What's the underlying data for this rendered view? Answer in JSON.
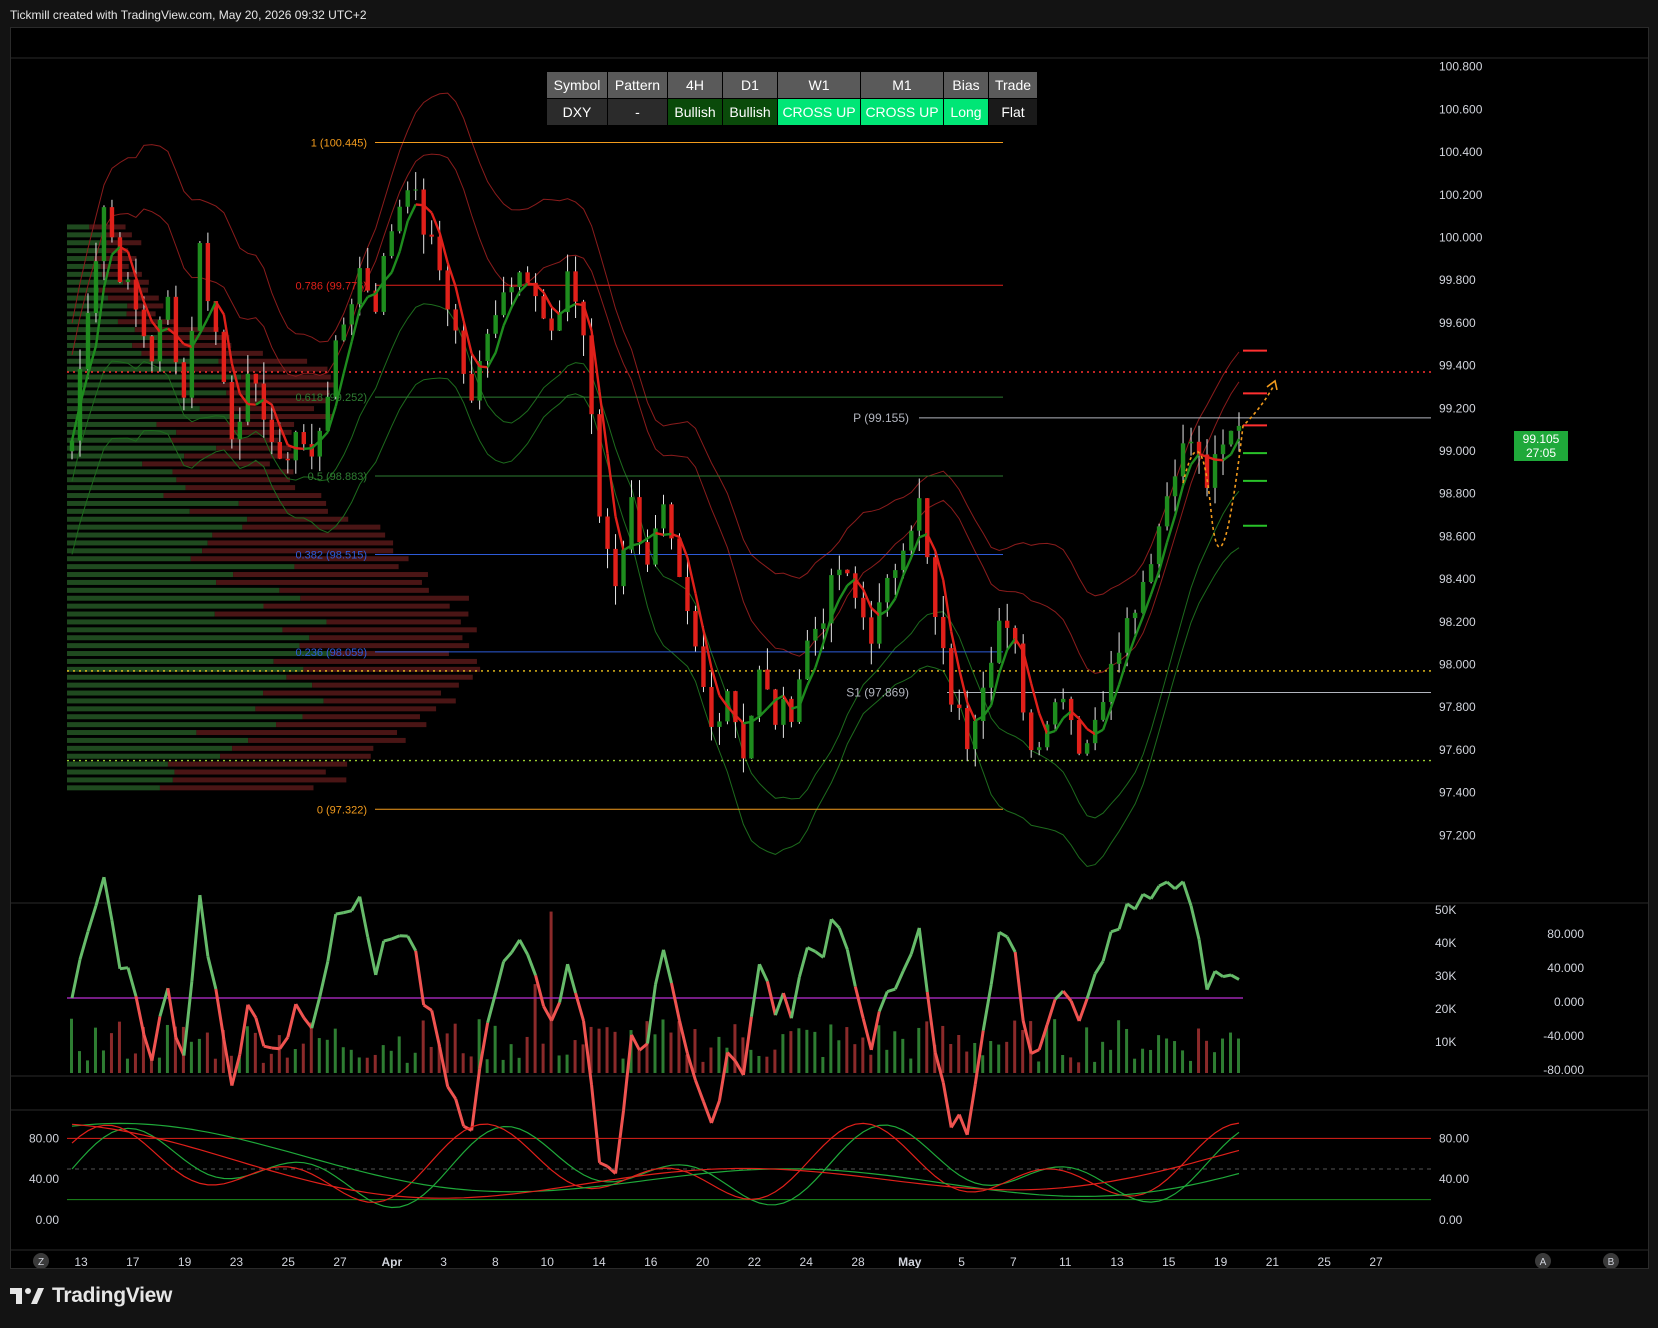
{
  "header": {
    "attribution": "Tickmill created with TradingView.com, May 20, 2026 09:32 UTC+2"
  },
  "branding": {
    "logo_text": "TradingView"
  },
  "summary_table": {
    "headers": [
      "Symbol",
      "Pattern",
      "4H",
      "D1",
      "W1",
      "M1",
      "Bias",
      "Trade"
    ],
    "values": [
      "DXY",
      "-",
      "Bullish",
      "Bullish",
      "CROSS UP",
      "CROSS UP",
      "Long",
      "Flat"
    ]
  },
  "colors": {
    "up": "#1e8c1e",
    "down": "#e0201a",
    "fib": "#f29b1d",
    "pivot": "#b2b5be",
    "volume_up": "#2e7d32",
    "volume_down": "#8b2a2a"
  },
  "last_price": {
    "value": "99.105",
    "countdown": "27:05"
  },
  "chart_data": [
    {
      "type": "candlestick",
      "symbol": "DXY",
      "ylim": [
        97.0,
        100.85
      ],
      "y_ticks": [
        "100.800",
        "100.600",
        "100.400",
        "100.200",
        "100.000",
        "99.800",
        "99.600",
        "99.400",
        "99.200",
        "99.000",
        "98.800",
        "98.600",
        "98.400",
        "98.200",
        "98.000",
        "97.800",
        "97.600",
        "97.400",
        "97.200"
      ],
      "x_ticks": [
        "13",
        "17",
        "19",
        "23",
        "25",
        "27",
        "Apr",
        "3",
        "8",
        "10",
        "14",
        "16",
        "20",
        "22",
        "24",
        "28",
        "May",
        "5",
        "7",
        "11",
        "13",
        "15",
        "19",
        "21",
        "25",
        "27"
      ],
      "fib_levels": [
        {
          "label": "1 (100.445)",
          "value": 100.445
        },
        {
          "label": "0.786 (99.776)",
          "value": 99.776
        },
        {
          "label": "0.618 (99.252)",
          "value": 99.252
        },
        {
          "label": "0.5 (98.883)",
          "value": 98.883
        },
        {
          "label": "0.382 (98.515)",
          "value": 98.515
        },
        {
          "label": "0.236 (98.059)",
          "value": 98.059
        },
        {
          "label": "0 (97.322)",
          "value": 97.322
        }
      ],
      "pivots": [
        {
          "label": "P (99.155)",
          "value": 99.155
        },
        {
          "label": "S1 (97.869)",
          "value": 97.869
        }
      ],
      "dotted_levels": [
        {
          "value": 99.37,
          "color": "#ff3030"
        },
        {
          "value": 97.97,
          "color": "#f2c71d"
        },
        {
          "value": 97.55,
          "color": "#9acd32"
        }
      ],
      "target_marks": [
        {
          "value": 99.47,
          "color": "#ff3030"
        },
        {
          "value": 99.27,
          "color": "#ff3030"
        },
        {
          "value": 99.12,
          "color": "#ff3030"
        },
        {
          "value": 98.99,
          "color": "#29c229"
        },
        {
          "value": 98.86,
          "color": "#29c229"
        },
        {
          "value": 98.65,
          "color": "#29c229"
        }
      ],
      "anchors": [
        [
          0,
          99.05
        ],
        [
          2,
          99.7
        ],
        [
          4,
          100.15
        ],
        [
          6,
          99.85
        ],
        [
          8,
          99.65
        ],
        [
          10,
          99.45
        ],
        [
          12,
          99.7
        ],
        [
          14,
          99.25
        ],
        [
          16,
          99.95
        ],
        [
          18,
          99.55
        ],
        [
          20,
          99.1
        ],
        [
          22,
          99.3
        ],
        [
          24,
          99.2
        ],
        [
          26,
          98.9
        ],
        [
          28,
          99.1
        ],
        [
          30,
          98.95
        ],
        [
          32,
          99.3
        ],
        [
          34,
          99.6
        ],
        [
          36,
          99.85
        ],
        [
          38,
          99.7
        ],
        [
          40,
          100.05
        ],
        [
          42,
          100.28
        ],
        [
          44,
          100.05
        ],
        [
          46,
          99.85
        ],
        [
          48,
          99.55
        ],
        [
          50,
          99.2
        ],
        [
          52,
          99.6
        ],
        [
          54,
          99.75
        ],
        [
          56,
          99.9
        ],
        [
          58,
          99.7
        ],
        [
          60,
          99.5
        ],
        [
          62,
          99.85
        ],
        [
          64,
          99.55
        ],
        [
          66,
          98.7
        ],
        [
          68,
          98.4
        ],
        [
          70,
          98.75
        ],
        [
          72,
          98.5
        ],
        [
          74,
          98.7
        ],
        [
          76,
          98.35
        ],
        [
          78,
          98.05
        ],
        [
          80,
          97.7
        ],
        [
          82,
          97.9
        ],
        [
          84,
          97.6
        ],
        [
          86,
          97.95
        ],
        [
          88,
          97.75
        ],
        [
          90,
          97.8
        ],
        [
          92,
          98.1
        ],
        [
          94,
          98.25
        ],
        [
          96,
          98.45
        ],
        [
          98,
          98.3
        ],
        [
          100,
          98.15
        ],
        [
          102,
          98.35
        ],
        [
          104,
          98.6
        ],
        [
          106,
          98.75
        ],
        [
          108,
          98.2
        ],
        [
          110,
          97.85
        ],
        [
          112,
          97.65
        ],
        [
          114,
          97.95
        ],
        [
          116,
          98.2
        ],
        [
          118,
          98.05
        ],
        [
          120,
          97.6
        ],
        [
          122,
          97.75
        ],
        [
          124,
          97.9
        ],
        [
          126,
          97.62
        ],
        [
          128,
          97.7
        ],
        [
          130,
          98.05
        ],
        [
          132,
          98.2
        ],
        [
          134,
          98.4
        ],
        [
          136,
          98.65
        ],
        [
          138,
          98.95
        ],
        [
          140,
          99.05
        ],
        [
          142,
          98.85
        ],
        [
          144,
          99.0
        ],
        [
          146,
          99.15
        ]
      ]
    },
    {
      "type": "bar",
      "name": "volume",
      "y_ticks": [
        "50K",
        "40K",
        "30K",
        "20K",
        "10K"
      ],
      "oscillator_ticks": [
        "80.000",
        "40.000",
        "0.000",
        "-40.000",
        "-80.000"
      ]
    },
    {
      "type": "line",
      "name": "stochastic",
      "ylim": [
        0,
        100
      ],
      "y_ticks": [
        "80.00",
        "40.00",
        "0.00"
      ],
      "levels": [
        80,
        50,
        20
      ]
    }
  ],
  "corner_buttons": [
    "Z",
    "A",
    "B"
  ]
}
